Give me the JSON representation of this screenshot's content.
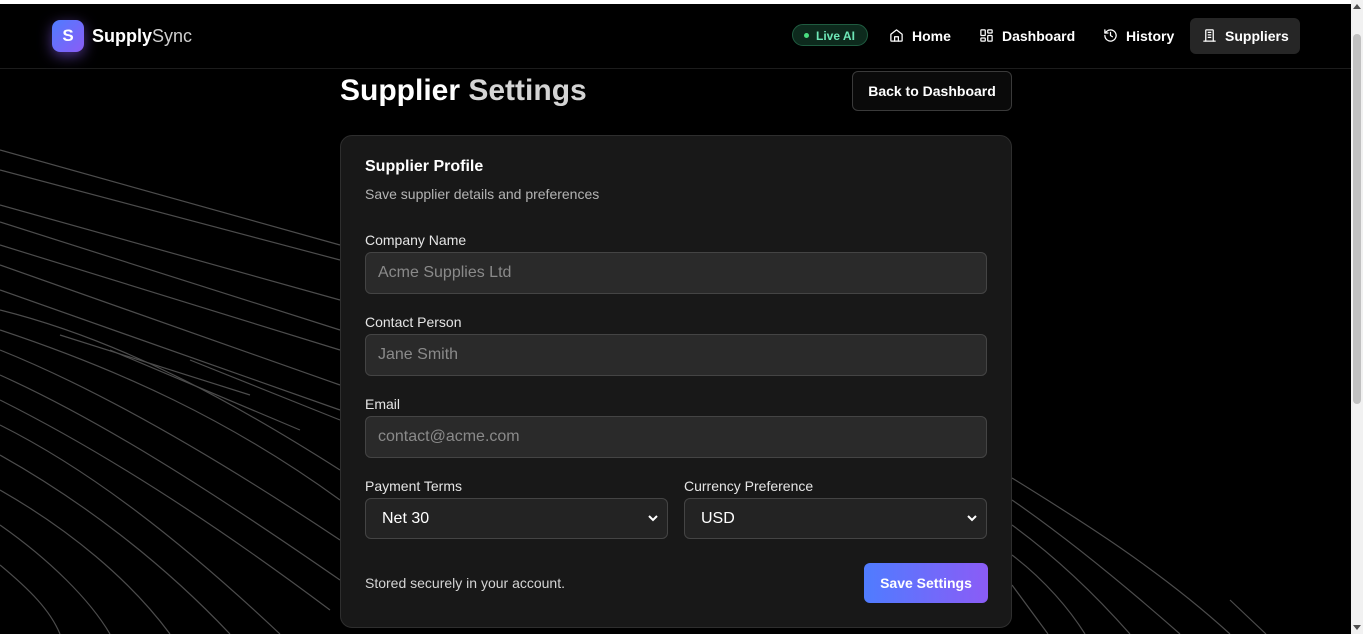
{
  "brand": {
    "mark": "S",
    "name_part1": "Supply",
    "name_part2": "Sync"
  },
  "nav": {
    "badge": "Live AI",
    "items": [
      {
        "label": "Home",
        "icon": "home-icon"
      },
      {
        "label": "Dashboard",
        "icon": "grid-icon"
      },
      {
        "label": "History",
        "icon": "history-icon"
      },
      {
        "label": "Suppliers",
        "icon": "building-icon",
        "active": true
      }
    ]
  },
  "page": {
    "title_part1": "Supplier",
    "title_part2": "Settings",
    "back_button": "Back to Dashboard"
  },
  "card": {
    "title": "Supplier Profile",
    "subtitle": "Save supplier details and preferences",
    "fields": {
      "company_name": {
        "label": "Company Name",
        "placeholder": "Acme Supplies Ltd",
        "value": ""
      },
      "contact_person": {
        "label": "Contact Person",
        "placeholder": "Jane Smith",
        "value": ""
      },
      "email": {
        "label": "Email",
        "placeholder": "contact@acme.com",
        "value": ""
      },
      "payment_terms": {
        "label": "Payment Terms",
        "selected": "Net 30"
      },
      "currency": {
        "label": "Currency Preference",
        "selected": "USD"
      }
    },
    "footer_note": "Stored securely in your account.",
    "save_button": "Save Settings"
  },
  "colors": {
    "background": "#000000",
    "card": "#1a1a1a",
    "accent_start": "#4f7cff",
    "accent_end": "#8b5cf6",
    "live_green": "#4ade80"
  }
}
